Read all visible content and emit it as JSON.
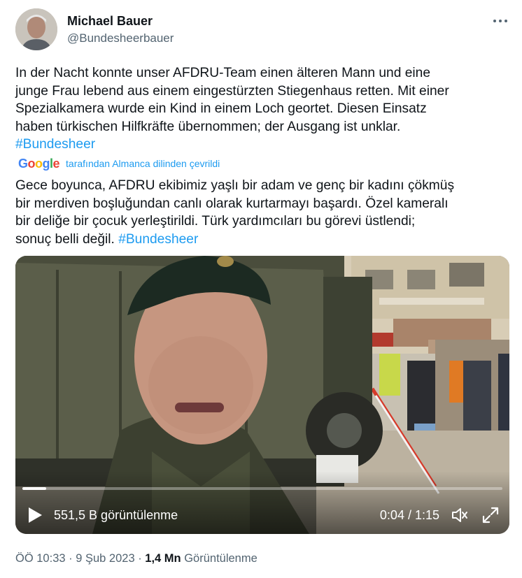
{
  "author": {
    "name": "Michael Bauer",
    "handle": "@Bundesheerbauer"
  },
  "tweet": {
    "text": "In der Nacht konnte unser AFDRU-Team einen älteren Mann und eine\njunge Frau lebend aus einem eingestürzten Stiegenhaus retten. Mit einer\nSpezialkamera wurde ein Kind in einem Loch geortet. Diesen Einsatz\nhaben türkischen Hilfkräfte übernommen; der Ausgang ist unklar.",
    "hashtag": "#Bundesheer"
  },
  "translation": {
    "logo_letters": [
      "G",
      "o",
      "o",
      "g",
      "l",
      "e"
    ],
    "credit": "tarafından Almanca dilinden çevrildi",
    "text": "Gece boyunca, AFDRU ekibimiz yaşlı bir adam ve genç bir kadını çökmüş\nbir merdiven boşluğundan canlı olarak kurtarmayı başardı. Özel kameralı\nbir deliğe bir çocuk yerleştirildi. Türk yardımcıları bu görevi üstlendi;\nsonuç belli değil. ",
    "hashtag": "#Bundesheer"
  },
  "video": {
    "views": "551,5 B görüntülenme",
    "time": "0:04 / 1:15",
    "progress_fraction": 0.05,
    "icons": [
      "play-icon",
      "volume-muted-icon",
      "fullscreen-icon"
    ]
  },
  "meta": {
    "timestamp": "ÖÖ 10:33 · 9 Şub 2023 · ",
    "view_count": "1,4 Mn",
    "view_label": " Görüntülenme"
  },
  "colors": {
    "link": "#1d9bf0",
    "text": "#0f1419",
    "secondary": "#536471"
  }
}
